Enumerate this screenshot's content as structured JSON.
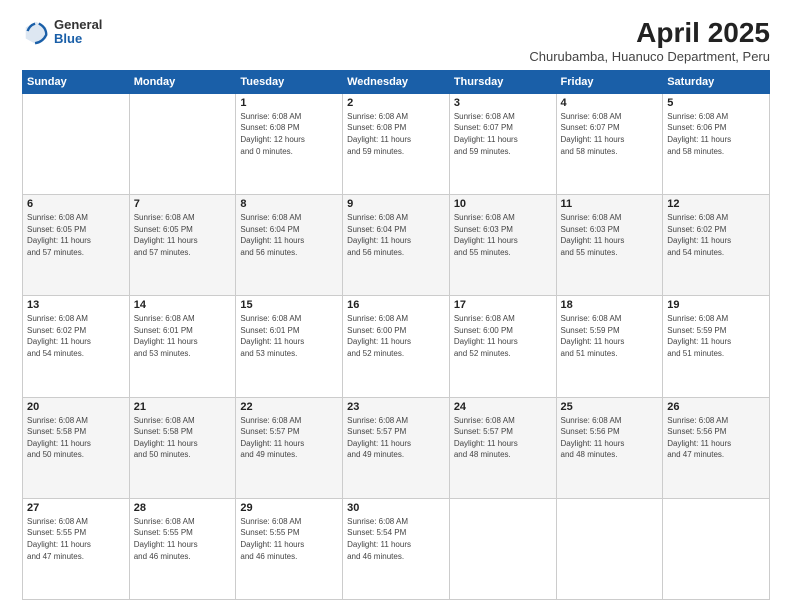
{
  "logo": {
    "general": "General",
    "blue": "Blue"
  },
  "title": "April 2025",
  "location": "Churubamba, Huanuco Department, Peru",
  "days_of_week": [
    "Sunday",
    "Monday",
    "Tuesday",
    "Wednesday",
    "Thursday",
    "Friday",
    "Saturday"
  ],
  "weeks": [
    [
      {
        "day": "",
        "info": ""
      },
      {
        "day": "",
        "info": ""
      },
      {
        "day": "1",
        "info": "Sunrise: 6:08 AM\nSunset: 6:08 PM\nDaylight: 12 hours\nand 0 minutes."
      },
      {
        "day": "2",
        "info": "Sunrise: 6:08 AM\nSunset: 6:08 PM\nDaylight: 11 hours\nand 59 minutes."
      },
      {
        "day": "3",
        "info": "Sunrise: 6:08 AM\nSunset: 6:07 PM\nDaylight: 11 hours\nand 59 minutes."
      },
      {
        "day": "4",
        "info": "Sunrise: 6:08 AM\nSunset: 6:07 PM\nDaylight: 11 hours\nand 58 minutes."
      },
      {
        "day": "5",
        "info": "Sunrise: 6:08 AM\nSunset: 6:06 PM\nDaylight: 11 hours\nand 58 minutes."
      }
    ],
    [
      {
        "day": "6",
        "info": "Sunrise: 6:08 AM\nSunset: 6:05 PM\nDaylight: 11 hours\nand 57 minutes."
      },
      {
        "day": "7",
        "info": "Sunrise: 6:08 AM\nSunset: 6:05 PM\nDaylight: 11 hours\nand 57 minutes."
      },
      {
        "day": "8",
        "info": "Sunrise: 6:08 AM\nSunset: 6:04 PM\nDaylight: 11 hours\nand 56 minutes."
      },
      {
        "day": "9",
        "info": "Sunrise: 6:08 AM\nSunset: 6:04 PM\nDaylight: 11 hours\nand 56 minutes."
      },
      {
        "day": "10",
        "info": "Sunrise: 6:08 AM\nSunset: 6:03 PM\nDaylight: 11 hours\nand 55 minutes."
      },
      {
        "day": "11",
        "info": "Sunrise: 6:08 AM\nSunset: 6:03 PM\nDaylight: 11 hours\nand 55 minutes."
      },
      {
        "day": "12",
        "info": "Sunrise: 6:08 AM\nSunset: 6:02 PM\nDaylight: 11 hours\nand 54 minutes."
      }
    ],
    [
      {
        "day": "13",
        "info": "Sunrise: 6:08 AM\nSunset: 6:02 PM\nDaylight: 11 hours\nand 54 minutes."
      },
      {
        "day": "14",
        "info": "Sunrise: 6:08 AM\nSunset: 6:01 PM\nDaylight: 11 hours\nand 53 minutes."
      },
      {
        "day": "15",
        "info": "Sunrise: 6:08 AM\nSunset: 6:01 PM\nDaylight: 11 hours\nand 53 minutes."
      },
      {
        "day": "16",
        "info": "Sunrise: 6:08 AM\nSunset: 6:00 PM\nDaylight: 11 hours\nand 52 minutes."
      },
      {
        "day": "17",
        "info": "Sunrise: 6:08 AM\nSunset: 6:00 PM\nDaylight: 11 hours\nand 52 minutes."
      },
      {
        "day": "18",
        "info": "Sunrise: 6:08 AM\nSunset: 5:59 PM\nDaylight: 11 hours\nand 51 minutes."
      },
      {
        "day": "19",
        "info": "Sunrise: 6:08 AM\nSunset: 5:59 PM\nDaylight: 11 hours\nand 51 minutes."
      }
    ],
    [
      {
        "day": "20",
        "info": "Sunrise: 6:08 AM\nSunset: 5:58 PM\nDaylight: 11 hours\nand 50 minutes."
      },
      {
        "day": "21",
        "info": "Sunrise: 6:08 AM\nSunset: 5:58 PM\nDaylight: 11 hours\nand 50 minutes."
      },
      {
        "day": "22",
        "info": "Sunrise: 6:08 AM\nSunset: 5:57 PM\nDaylight: 11 hours\nand 49 minutes."
      },
      {
        "day": "23",
        "info": "Sunrise: 6:08 AM\nSunset: 5:57 PM\nDaylight: 11 hours\nand 49 minutes."
      },
      {
        "day": "24",
        "info": "Sunrise: 6:08 AM\nSunset: 5:57 PM\nDaylight: 11 hours\nand 48 minutes."
      },
      {
        "day": "25",
        "info": "Sunrise: 6:08 AM\nSunset: 5:56 PM\nDaylight: 11 hours\nand 48 minutes."
      },
      {
        "day": "26",
        "info": "Sunrise: 6:08 AM\nSunset: 5:56 PM\nDaylight: 11 hours\nand 47 minutes."
      }
    ],
    [
      {
        "day": "27",
        "info": "Sunrise: 6:08 AM\nSunset: 5:55 PM\nDaylight: 11 hours\nand 47 minutes."
      },
      {
        "day": "28",
        "info": "Sunrise: 6:08 AM\nSunset: 5:55 PM\nDaylight: 11 hours\nand 46 minutes."
      },
      {
        "day": "29",
        "info": "Sunrise: 6:08 AM\nSunset: 5:55 PM\nDaylight: 11 hours\nand 46 minutes."
      },
      {
        "day": "30",
        "info": "Sunrise: 6:08 AM\nSunset: 5:54 PM\nDaylight: 11 hours\nand 46 minutes."
      },
      {
        "day": "",
        "info": ""
      },
      {
        "day": "",
        "info": ""
      },
      {
        "day": "",
        "info": ""
      }
    ]
  ]
}
